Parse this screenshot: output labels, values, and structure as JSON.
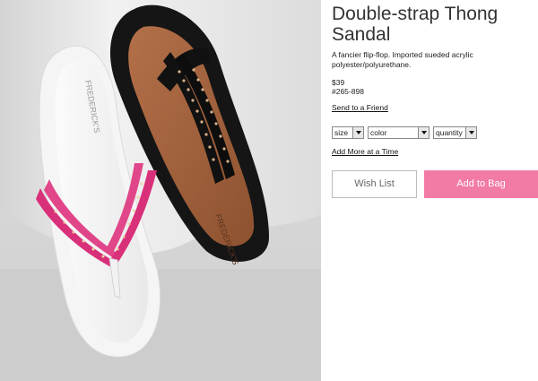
{
  "product": {
    "title": "Double-strap Thong Sandal",
    "description": "A fancier flip-flop. Imported sueded acrylic polyester/polyurethane.",
    "price": "$39",
    "sku": "#265-898"
  },
  "links": {
    "send_to_friend": "Send to a Friend",
    "add_more": "Add More at a Time"
  },
  "options": {
    "size_label": "size",
    "color_label": "color",
    "quantity_label": "quantity"
  },
  "buttons": {
    "wish_list": "Wish List",
    "add_to_bag": "Add to Bag"
  },
  "colors": {
    "accent_pink": "#f27aa6",
    "strap_magenta": "#d9307a",
    "strap_black": "#1a1a1a",
    "footbed_tan": "#a5643f"
  },
  "photo": {
    "sole_imprint_white": "FREDERICK'S",
    "sole_imprint_black": "FREDERICK'S"
  }
}
